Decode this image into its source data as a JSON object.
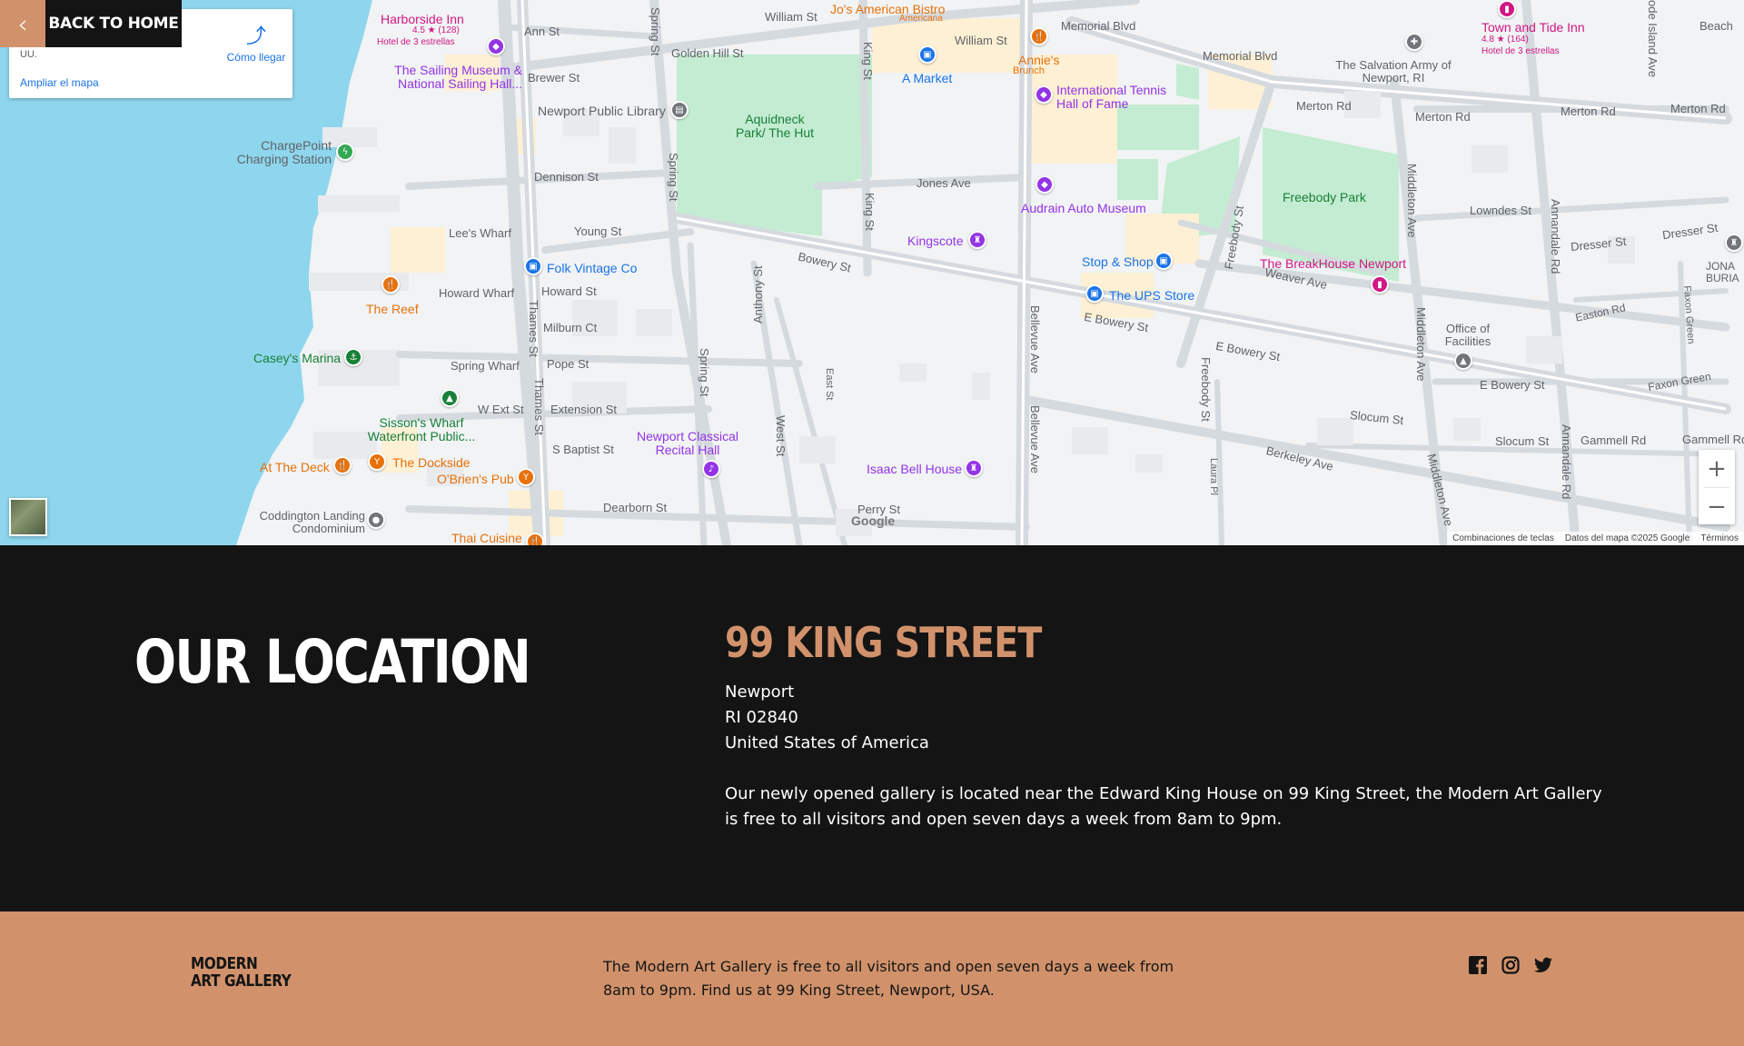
{
  "back_link": {
    "arrow": "‹",
    "label": "BACK TO HOME"
  },
  "map": {
    "info_card": {
      "address_fragment": "UU.",
      "directions_label": "Cómo llegar",
      "directions_icon": "directions-icon",
      "enlarge_label": "Ampliar el mapa"
    },
    "streets": {
      "william_st": "William St",
      "william_st2": "William St",
      "memorial_blvd": "Memorial Blvd",
      "memorial_blvd2": "Memorial Blvd",
      "ann_st": "Ann St",
      "golden_hill": "Golden Hill St",
      "brewer_st": "Brewer St",
      "spring_st": "Spring St",
      "spring_st2": "Spring St",
      "spring_st3": "Spring St",
      "king_st": "King St",
      "king_st2": "King St",
      "dennison_st": "Dennison St",
      "jones_ave": "Jones Ave",
      "lees_wharf": "Lee's Wharf",
      "young_st": "Young St",
      "bowery_st": "Bowery St",
      "howard_wharf": "Howard Wharf",
      "howard_st": "Howard St",
      "milburn_ct": "Milburn Ct",
      "thames_st": "Thames St",
      "thames_st2": "Thames St",
      "anthony_st": "Anthony St",
      "spring_wharf": "Spring Wharf",
      "pope_st": "Pope St",
      "w_ext_st": "W Ext St",
      "extension_st": "Extension St",
      "s_baptist_st": "S Baptist St",
      "east_st": "East St",
      "west_st": "West St",
      "dearborn_st": "Dearborn St",
      "perry_st": "Perry St",
      "bellevue_ave": "Bellevue Ave",
      "bellevue_ave2": "Bellevue Ave",
      "e_bowery_st": "E Bowery St",
      "e_bowery_st2": "E Bowery St",
      "e_bowery_st3": "E Bowery St",
      "freebody_st": "Freebody St",
      "freebody_st2": "Freebody St",
      "laura_pl": "Laura Pl",
      "weaver_ave": "Weaver Ave",
      "merton_rd": "Merton Rd",
      "merton_rd2": "Merton Rd",
      "merton_rd3": "Merton Rd",
      "merton_rd4": "Merton Rd",
      "lowndes_st": "Lowndes St",
      "dresser_st": "Dresser St",
      "dresser_st2": "Dresser St",
      "middleton_ave": "Middleton Ave",
      "middleton_ave2": "Middleton Ave",
      "middleton_ave3": "Middleton Ave",
      "annandale_rd": "Annandale Rd",
      "annandale_rd2": "Annandale Rd",
      "easton_rd": "Easton Rd",
      "faxon_green": "Faxon Green",
      "faxon_green2": "Faxon Green",
      "slocum_st": "Slocum St",
      "slocum_st2": "Slocum St",
      "gammell_rd": "Gammell Rd",
      "gammell_rd2": "Gammell Rd",
      "berkeley_ave": "Berkeley Ave",
      "beach": "Beach",
      "rhode_island_ave": "ode Island Ave"
    },
    "pois": {
      "harborside": "Harborside Inn",
      "harborside_rating": "4.5 ★ (128)",
      "harborside_type": "Hotel de 3 estrellas",
      "sailing_museum": "The Sailing Museum & National Sailing Hall...",
      "jos": "Jo's American Bistro",
      "jos_type": "Americana",
      "annies": "Annie's",
      "annies_type": "Brunch",
      "a_market": "A Market",
      "tennis": "International Tennis Hall of Fame",
      "salvation": "The Salvation Army of Newport, RI",
      "town_tide": "Town and Tide Inn",
      "town_tide_rating": "4.8 ★ (164)",
      "town_tide_type": "Hotel de 3 estrellas",
      "library": "Newport Public Library",
      "aquidneck": "Aquidneck Park/ The Hut",
      "chargepoint": "ChargePoint Charging Station",
      "audrain": "Audrain Auto Museum",
      "freebody_park": "Freebody Park",
      "kingscote": "Kingscote",
      "folk_vintage": "Folk Vintage Co",
      "stop_shop": "Stop & Shop",
      "ups": "The UPS Store",
      "breakhouse": "The BreakHouse Newport",
      "reef": "The Reef",
      "caseys": "Casey's Marina",
      "office_fac": "Office of Facilities",
      "jona": "JONA BURIA",
      "sissons": "Sisson's Wharf Waterfront Public...",
      "newport_classical": "Newport Classical Recital Hall",
      "at_the_deck": "At The Deck",
      "dockside": "The Dockside",
      "obriens": "O'Brien's Pub",
      "isaac_bell": "Isaac Bell House",
      "coddington": "Coddington Landing Condominium",
      "thai": "Thai Cuisine"
    },
    "zoom_in": "+",
    "zoom_out": "−",
    "google_logo": "Google",
    "attribution": {
      "shortcuts": "Combinaciones de teclas",
      "data": "Datos del mapa ©2025 Google",
      "terms": "Términos"
    }
  },
  "location": {
    "heading": "OUR LOCATION",
    "street": "99 KING STREET",
    "city": "Newport",
    "state_zip": "RI 02840",
    "country": "United States of America",
    "description": "Our newly opened gallery is located near the Edward King House on 99 King Street, the Modern Art Gallery is free to all visitors and open seven days a week from 8am to 9pm."
  },
  "footer": {
    "logo_line1": "MODERN",
    "logo_line2": "ART GALLERY",
    "text": "The Modern Art Gallery is free to all visitors and open seven days a week from 8am to 9pm. Find us at 99 King Street, Newport, USA.",
    "social": [
      "facebook-icon",
      "instagram-icon",
      "twitter-icon"
    ]
  },
  "colors": {
    "accent": "#d1926b",
    "dark": "#141414",
    "water": "#8ed6ed",
    "park": "#c3ecd2"
  }
}
